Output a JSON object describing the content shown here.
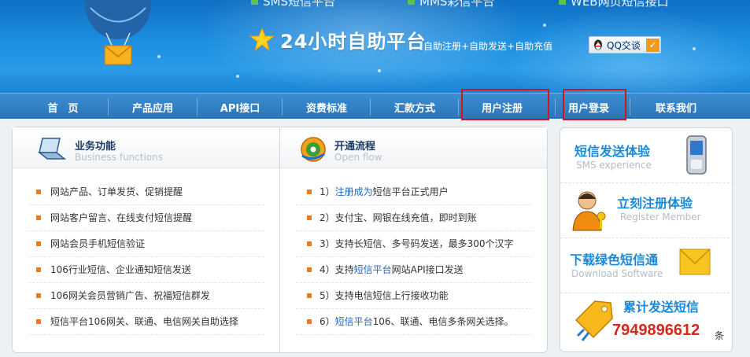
{
  "header": {
    "top_links": [
      "SMS短信平台",
      "MMS彩信平台",
      "WEB网页短信接口"
    ],
    "slogan_title": "24小时自助平台",
    "slogan_sub": "自助注册+自助发送+自助充值",
    "qq_label": "QQ交谈"
  },
  "nav": {
    "items": [
      "首　页",
      "产品应用",
      "API接口",
      "资费标准",
      "汇款方式",
      "用户注册",
      "用户登录",
      "联系我们"
    ]
  },
  "business": {
    "title": "业务功能",
    "subtitle": "Business functions",
    "items": [
      "网站产品、订单发货、促销提醒",
      "网站客户留言、在线支付短信提醒",
      "网站会员手机短信验证",
      "106行业短信、企业通知短信发送",
      "106网关会员营销广告、祝福短信群发",
      "短信平台106网关、联通、电信网关自助选择"
    ]
  },
  "flow": {
    "title": "开通流程",
    "subtitle": "Open flow",
    "step1_prefix": "1）",
    "step1_link": "注册成为",
    "step1_suffix": "短信平台正式用户",
    "step2": "2）支付宝、网银在线充值，即时到账",
    "step3": "3）支持长短信、多号码发送，最多300个汉字",
    "step4_prefix": "4）支持",
    "step4_link": "短信平台",
    "step4_suffix": "网站API接口发送",
    "step5": "5）支持电信短信上行接收功能",
    "step6_prefix": "6）",
    "step6_link": "短信平台",
    "step6_suffix": "106、联通、电信多条网关选择。"
  },
  "right": {
    "sms_title": "短信发送体验",
    "sms_sub": "SMS experience",
    "register_title": "立刻注册体验",
    "register_sub": "Register Member",
    "download_title": "下载绿色短信通",
    "download_sub": "Download Software",
    "total_title": "累计发送短信",
    "total_count": "7949896612",
    "total_unit": "条"
  },
  "colors": {
    "highlight_box": "#d0161d",
    "nav_bg": "#2b74b8",
    "link": "#1a68c6",
    "counter": "#d9261c"
  }
}
